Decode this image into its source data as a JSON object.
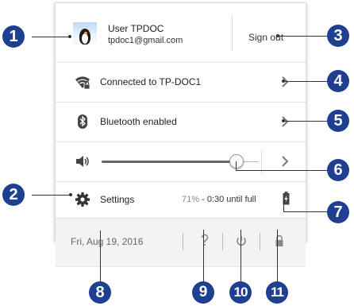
{
  "user": {
    "name": "User TPDOC",
    "email": "tpdoc1@gmail.com",
    "avatar_icon": "penguin-avatar",
    "sign_out_label": "Sign out"
  },
  "network": {
    "label": "Connected to TP-DOC1",
    "icon": "wifi-locked-icon"
  },
  "bluetooth": {
    "label": "Bluetooth enabled",
    "icon": "bluetooth-icon"
  },
  "volume": {
    "icon": "speaker-icon",
    "level_fraction": 0.92
  },
  "settings": {
    "label": "Settings",
    "icon": "gear-icon"
  },
  "battery": {
    "percent": "71%",
    "separator": " - ",
    "time_left": "0:30 until full",
    "icon": "battery-charging-icon"
  },
  "footer": {
    "date": "Fri, Aug 19, 2016",
    "help_icon": "help-icon",
    "power_icon": "power-icon",
    "lock_icon": "lock-icon"
  },
  "callouts": [
    "1",
    "2",
    "3",
    "4",
    "5",
    "6",
    "7",
    "8",
    "9",
    "10",
    "11"
  ],
  "colors": {
    "callout_fill": "#1f3f91",
    "panel_bg": "#ffffff",
    "footer_bg": "#f3f3f3"
  }
}
